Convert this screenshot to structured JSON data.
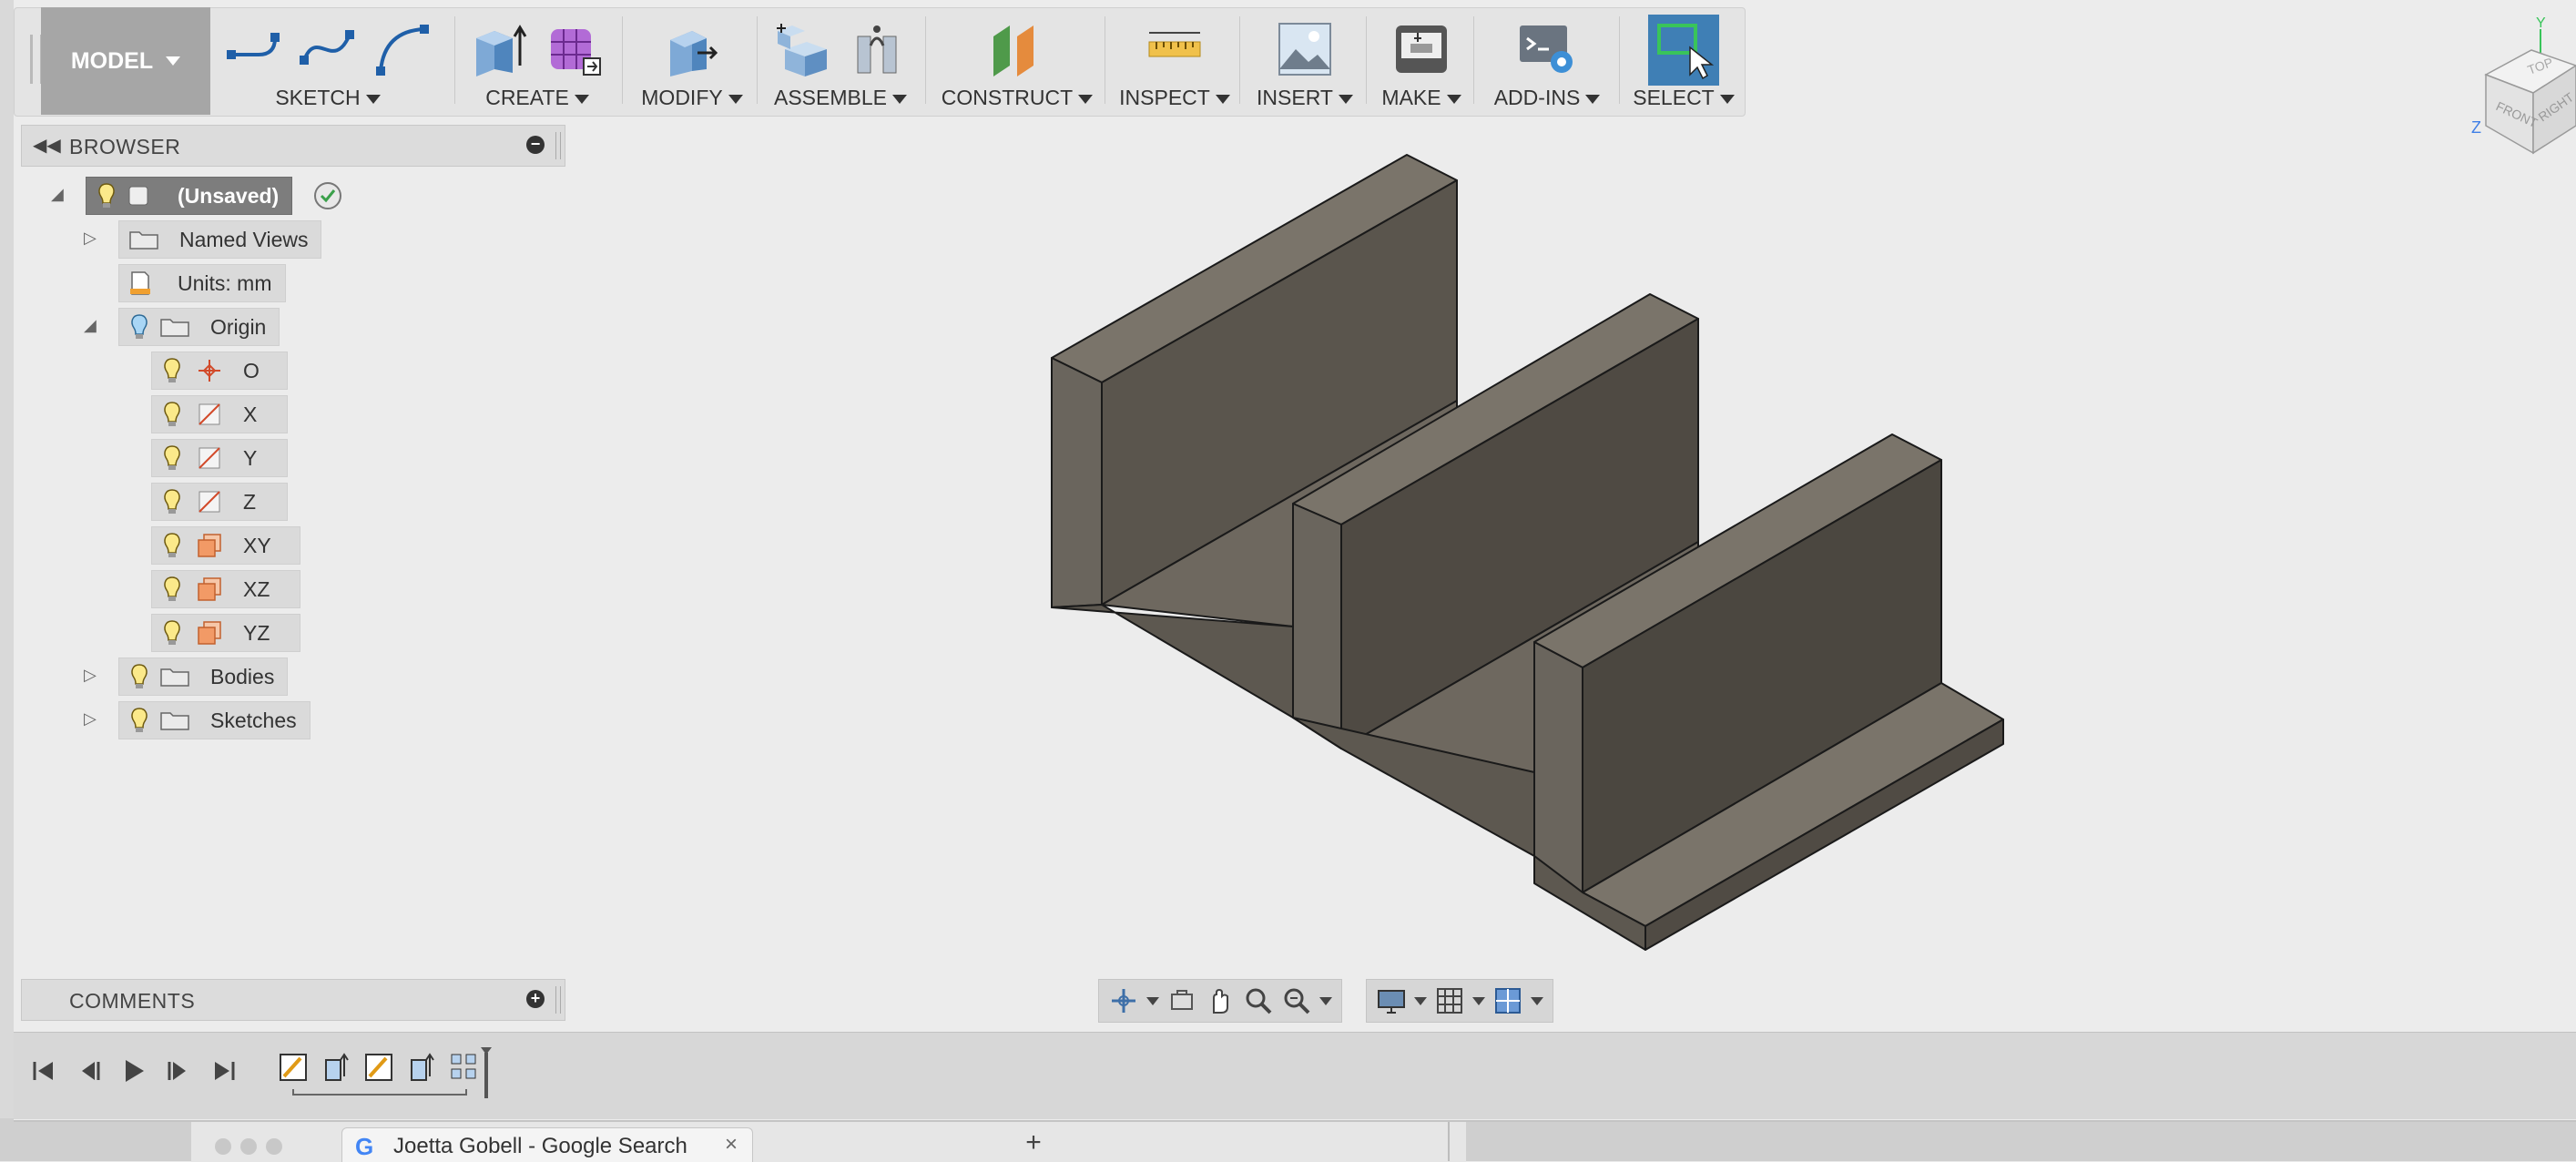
{
  "toolbar": {
    "model_label": "MODEL",
    "groups": [
      {
        "label": "SKETCH"
      },
      {
        "label": "CREATE"
      },
      {
        "label": "MODIFY"
      },
      {
        "label": "ASSEMBLE"
      },
      {
        "label": "CONSTRUCT"
      },
      {
        "label": "INSPECT"
      },
      {
        "label": "INSERT"
      },
      {
        "label": "MAKE"
      },
      {
        "label": "ADD-INS"
      },
      {
        "label": "SELECT"
      }
    ]
  },
  "browser": {
    "title": "BROWSER",
    "root": "(Unsaved)",
    "named_views": "Named Views",
    "units": "Units: mm",
    "origin": "Origin",
    "origin_items": [
      "O",
      "X",
      "Y",
      "Z",
      "XY",
      "XZ",
      "YZ"
    ],
    "bodies": "Bodies",
    "sketches": "Sketches"
  },
  "comments": {
    "title": "COMMENTS"
  },
  "viewcube": {
    "top": "TOP",
    "front": "FRONT",
    "right": "RIGHT",
    "axis_y": "Y",
    "axis_z": "Z"
  },
  "background": {
    "tab_title": "Joetta Gobell - Google Search",
    "tab_logo": "G",
    "tab_close": "×",
    "new_tab": "+"
  },
  "colors": {
    "model_face_light": "#7a746a",
    "model_face_mid": "#5a554d",
    "model_face_dark": "#4b4740",
    "select_active": "#3f7fb5"
  }
}
